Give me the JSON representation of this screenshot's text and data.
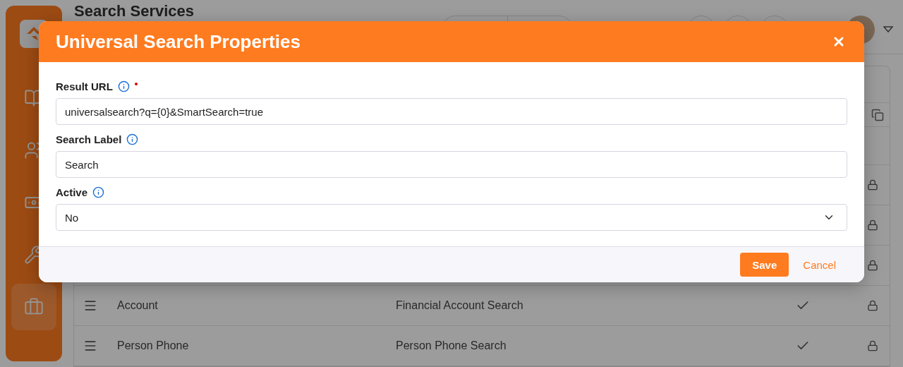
{
  "page": {
    "title": "Search Services"
  },
  "sidebar": {
    "items": [
      {
        "kind": "book",
        "selected": false
      },
      {
        "kind": "users",
        "selected": false
      },
      {
        "kind": "cash",
        "selected": false
      },
      {
        "kind": "tools",
        "selected": false
      },
      {
        "kind": "briefcase",
        "selected": true
      }
    ]
  },
  "table": {
    "rows": [
      {
        "locked": true
      },
      {
        "locked": true
      },
      {
        "locked": true
      },
      {
        "name": "Account",
        "service": "Financial Account Search",
        "active": true,
        "locked": true
      },
      {
        "name": "Person Phone",
        "service": "Person Phone Search",
        "active": true,
        "locked": true
      }
    ]
  },
  "dialog": {
    "title": "Universal Search Properties",
    "fields": [
      {
        "kind": "text",
        "label": "Result URL",
        "required": true,
        "value": "universalsearch?q={0}&SmartSearch=true"
      },
      {
        "kind": "text",
        "label": "Search Label",
        "required": false,
        "value": "Search"
      },
      {
        "kind": "select",
        "label": "Active",
        "required": false,
        "value": "No"
      }
    ],
    "save": "Save",
    "cancel": "Cancel"
  }
}
